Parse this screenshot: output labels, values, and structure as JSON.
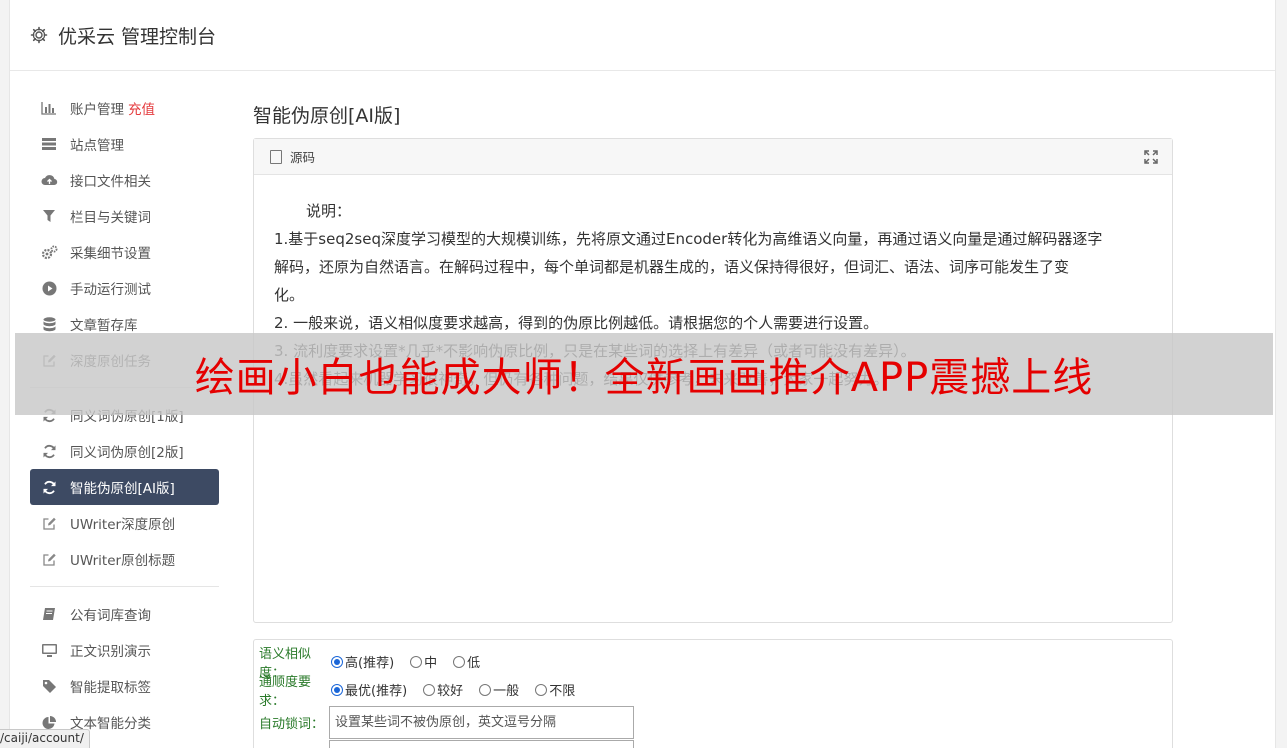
{
  "header": {
    "title": "优采云 管理控制台"
  },
  "sidebar": {
    "group1": [
      {
        "icon": "bar-chart-icon",
        "label": "账户管理",
        "tag": "充值"
      },
      {
        "icon": "server-icon",
        "label": "站点管理"
      },
      {
        "icon": "cloud-upload-icon",
        "label": "接口文件相关"
      },
      {
        "icon": "filter-icon",
        "label": "栏目与关键词"
      },
      {
        "icon": "gears-icon",
        "label": "采集细节设置"
      },
      {
        "icon": "play-icon",
        "label": "手动运行测试"
      },
      {
        "icon": "database-icon",
        "label": "文章暂存库"
      },
      {
        "icon": "edit-icon",
        "label": "深度原创任务"
      }
    ],
    "group2": [
      {
        "icon": "refresh-icon",
        "label": "同义词伪原创[1版]"
      },
      {
        "icon": "refresh-icon",
        "label": "同义词伪原创[2版]"
      },
      {
        "icon": "refresh-icon",
        "label": "智能伪原创[AI版]",
        "active": true
      },
      {
        "icon": "edit-icon",
        "label": "UWriter深度原创"
      },
      {
        "icon": "edit-icon",
        "label": "UWriter原创标题"
      }
    ],
    "group3": [
      {
        "icon": "book-icon",
        "label": "公有词库查询"
      },
      {
        "icon": "monitor-icon",
        "label": "正文识别演示"
      },
      {
        "icon": "tag-icon",
        "label": "智能提取标签"
      },
      {
        "icon": "pie-chart-icon",
        "label": "文本智能分类"
      }
    ]
  },
  "main": {
    "title": "智能伪原创[AI版]",
    "editor": {
      "toolbar_label": "源码",
      "lines": [
        "说明：",
        "1.基于seq2seq深度学习模型的大规模训练，先将原文通过Encoder转化为高维语义向量，再通过语义向量是通过解码器逐字",
        "解码，还原为自然语言。在解码过程中，每个单词都是机器生成的，语义保持得很好，但词汇、语法、词序可能发生了变",
        "化。",
        "2. 一般来说，语义相似度要求越高，得到的伪原比例越低。请根据您的个人需要进行设置。",
        "3. 流利度要求设置*几乎*不影响伪原比例，只是在某些词的选择上有差异（或者可能没有差异）。",
        "4.虽然看起来机器学习很神奇，但仍有各种问题，结果仅供参考，未来改善，大家一起努力。"
      ]
    },
    "options": {
      "similarity": {
        "label": "语义相似度：",
        "choices": [
          "高(推荐)",
          "中",
          "低"
        ],
        "selected": "高(推荐)"
      },
      "fluency": {
        "label": "通顺度要求：",
        "choices": [
          "最优(推荐)",
          "较好",
          "一般",
          "不限"
        ],
        "selected": "最优(推荐)"
      },
      "lock": {
        "label": "自动锁词：",
        "placeholder": "设置某些词不被伪原创，英文逗号分隔"
      }
    }
  },
  "banner": {
    "text": "绘画小白也能成大师！全新画画推介APP震撼上线"
  },
  "statusbar": {
    "url": "/caiji/account/"
  },
  "colors": {
    "active_bg": "#3d4a63",
    "tag_red": "#e4393c",
    "option_label": "#2a7a2a",
    "banner_text": "#e50000"
  }
}
